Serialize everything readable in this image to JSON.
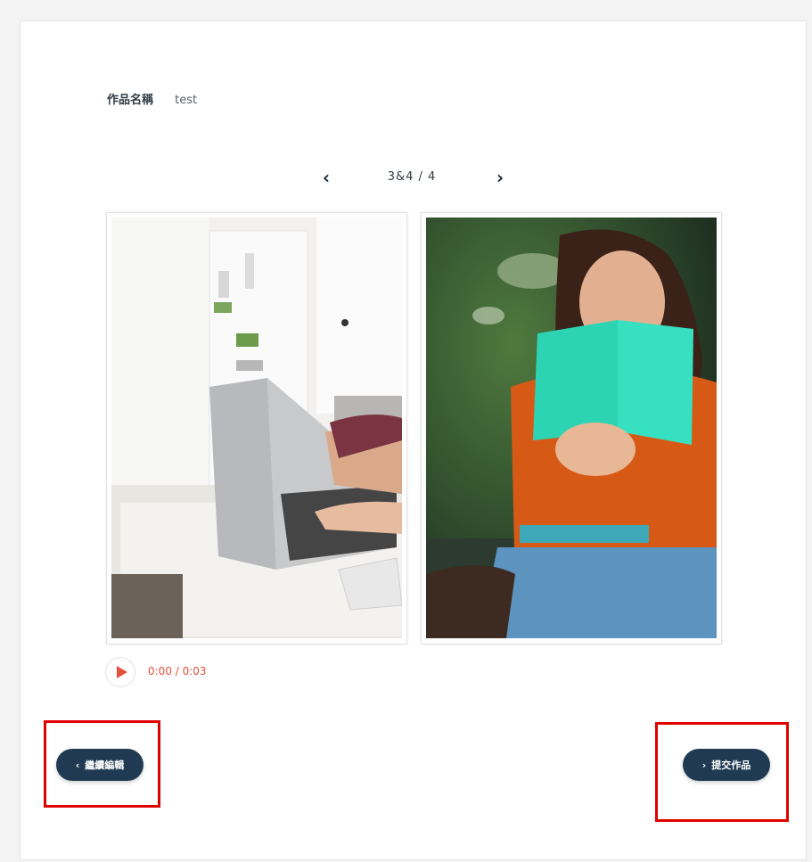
{
  "work": {
    "name_label": "作品名稱",
    "name_value": "test"
  },
  "pager": {
    "prev_icon": "chevron-left-icon",
    "count": "3&4 / 4",
    "next_icon": "chevron-right-icon"
  },
  "pages": [
    {
      "alt": "laptop on floor"
    },
    {
      "alt": "woman reading book"
    }
  ],
  "audio": {
    "time": "0:00 / 0:03",
    "accent": "#e3503c"
  },
  "buttons": {
    "back_label": "繼續編輯",
    "submit_label": "提交作品",
    "color": "#1f3a52"
  },
  "highlight_color": "#e00000"
}
